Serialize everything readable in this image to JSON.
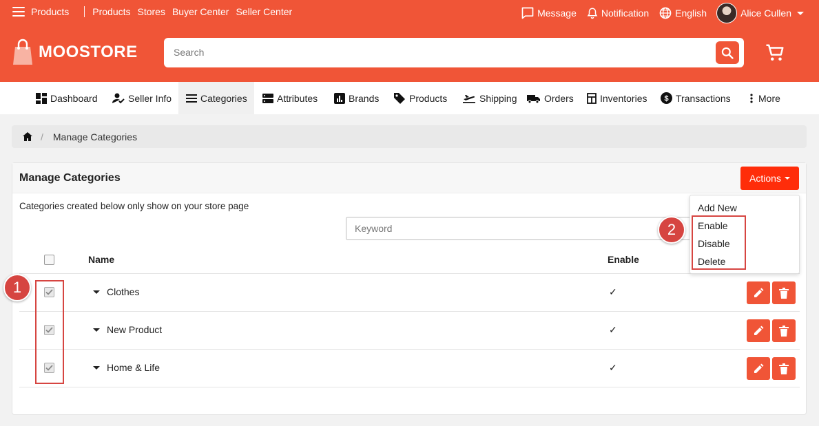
{
  "topbar": {
    "menu_label": "Products",
    "links": [
      "Products",
      "Stores",
      "Buyer Center",
      "Seller Center"
    ],
    "message": "Message",
    "notification": "Notification",
    "language": "English",
    "user": "Alice Cullen"
  },
  "brand": {
    "name": "MOOSTORE"
  },
  "search": {
    "placeholder": "Search"
  },
  "nav": {
    "items": [
      "Dashboard",
      "Seller Info",
      "Categories",
      "Attributes",
      "Brands",
      "Products",
      "Shipping",
      "Orders",
      "Inventories",
      "Transactions",
      "More"
    ],
    "active": "Categories"
  },
  "breadcrumb": {
    "current": "Manage Categories"
  },
  "panel": {
    "title": "Manage Categories",
    "actions_label": "Actions",
    "note": "Categories created below only show on your store page",
    "keyword_placeholder": "Keyword"
  },
  "table": {
    "headers": {
      "name": "Name",
      "enable": "Enable"
    },
    "rows": [
      {
        "name": "Clothes",
        "enabled": "✓",
        "selected": true
      },
      {
        "name": "New Product",
        "enabled": "✓",
        "selected": true
      },
      {
        "name": "Home & Life",
        "enabled": "✓",
        "selected": true
      }
    ]
  },
  "dropdown": {
    "items": [
      "Add New",
      "Enable",
      "Disable",
      "Delete"
    ]
  },
  "annotations": {
    "badge_1": "1",
    "badge_2": "2"
  },
  "colors": {
    "brand": "#f05537",
    "actions": "#ff2d0a",
    "annotation": "#d64541"
  }
}
